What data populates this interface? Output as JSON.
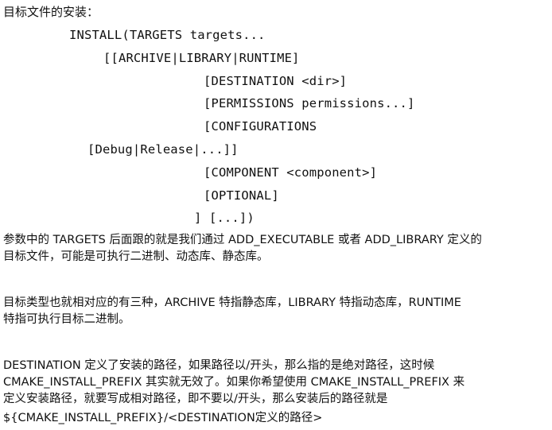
{
  "heading": "目标文件的安装：",
  "code": [
    "INSTALL(TARGETS targets...",
    "[[ARCHIVE|LIBRARY|RUNTIME]",
    "[DESTINATION <dir>]",
    "[PERMISSIONS permissions...]",
    "[CONFIGURATIONS",
    "[Debug|Release|...]]",
    "[COMPONENT <component>]",
    "[OPTIONAL]",
    "] [...])"
  ],
  "paragraphs": [
    "参数中的 TARGETS 后面跟的就是我们通过 ADD_EXECUTABLE 或者 ADD_LIBRARY 定义的\n目标文件，可能是可执行二进制、动态库、静态库。",
    "目标类型也就相对应的有三种，ARCHIVE 特指静态库，LIBRARY 特指动态库，RUNTIME\n特指可执行目标二进制。",
    "DESTINATION 定义了安装的路径，如果路径以/开头，那么指的是绝对路径，这时候\nCMAKE_INSTALL_PREFIX 其实就无效了。如果你希望使用 CMAKE_INSTALL_PREFIX 来\n定义安装路径，就要写成相对路径，即不要以/开头，那么安装后的路径就是",
    "${CMAKE_INSTALL_PREFIX}/<DESTINATION定义的路径>"
  ]
}
